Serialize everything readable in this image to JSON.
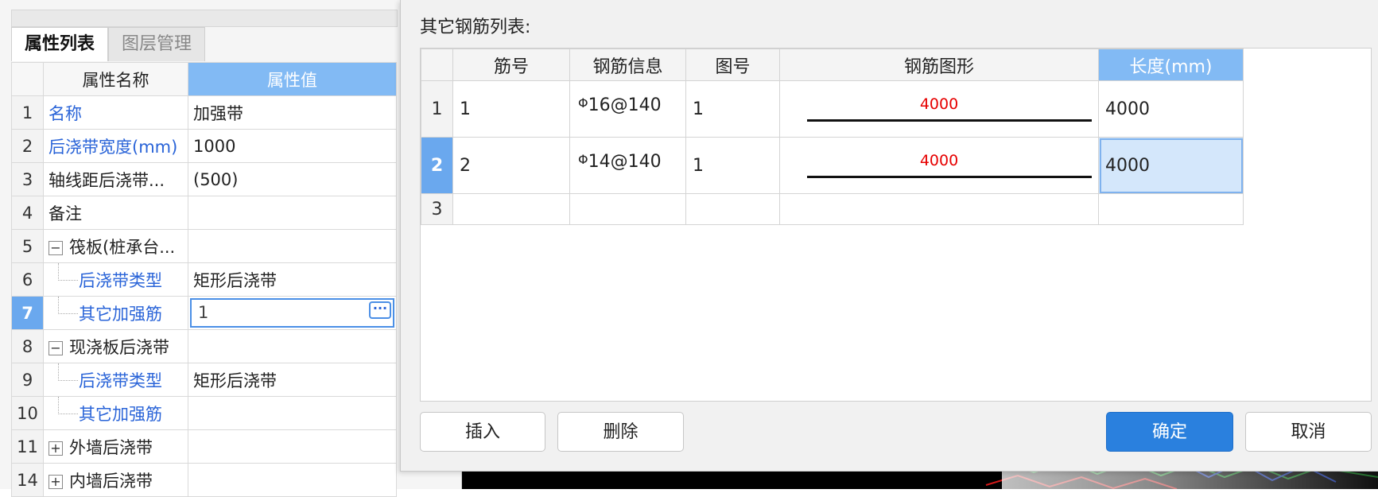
{
  "left_panel": {
    "tabs": [
      {
        "label": "属性列表",
        "active": true
      },
      {
        "label": "图层管理",
        "active": false
      }
    ],
    "columns": {
      "name": "属性名称",
      "value": "属性值"
    },
    "rows": [
      {
        "num": "1",
        "name": "名称",
        "value": "加强带"
      },
      {
        "num": "2",
        "name": "后浇带宽度(mm)",
        "value": "1000"
      },
      {
        "num": "3",
        "name": "轴线距后浇带...",
        "value": "(500)"
      },
      {
        "num": "4",
        "name": "备注",
        "value": ""
      },
      {
        "num": "5",
        "name": "筏板(桩承台...",
        "value": "",
        "expander": "−"
      },
      {
        "num": "6",
        "name": "后浇带类型",
        "value": "矩形后浇带"
      },
      {
        "num": "7",
        "name": "其它加强筋",
        "value": "1",
        "edit_button": "···"
      },
      {
        "num": "8",
        "name": "现浇板后浇带",
        "value": "",
        "expander": "−"
      },
      {
        "num": "9",
        "name": "后浇带类型",
        "value": "矩形后浇带"
      },
      {
        "num": "10",
        "name": "其它加强筋",
        "value": ""
      },
      {
        "num": "11",
        "name": "外墙后浇带",
        "value": "",
        "expander": "+"
      },
      {
        "num": "14",
        "name": "内墙后浇带",
        "value": "",
        "expander": "+"
      }
    ]
  },
  "dialog": {
    "title": "其它钢筋列表:",
    "columns": [
      "筋号",
      "钢筋信息",
      "图号",
      "钢筋图形",
      "长度(mm)"
    ],
    "rows": [
      {
        "num": "1",
        "bar_no": "1",
        "rebar_symbol": "Φ",
        "rebar_info": "16@140",
        "figure_no": "1",
        "shape_value": "4000",
        "length": "4000"
      },
      {
        "num": "2",
        "bar_no": "2",
        "rebar_symbol": "Φ",
        "rebar_info": "14@140",
        "figure_no": "1",
        "shape_value": "4000",
        "length": "4000"
      },
      {
        "num": "3",
        "bar_no": "",
        "rebar_symbol": "",
        "rebar_info": "",
        "figure_no": "",
        "shape_value": "",
        "length": ""
      }
    ],
    "buttons": {
      "insert": "插入",
      "delete": "删除",
      "ok": "确定",
      "cancel": "取消"
    }
  },
  "colors": {
    "header_selected": "#82baf4",
    "row_selected": "#6aa8ee",
    "link_blue": "#2a64d8",
    "shape_text": "#e60000",
    "primary_button": "#2a80de"
  }
}
